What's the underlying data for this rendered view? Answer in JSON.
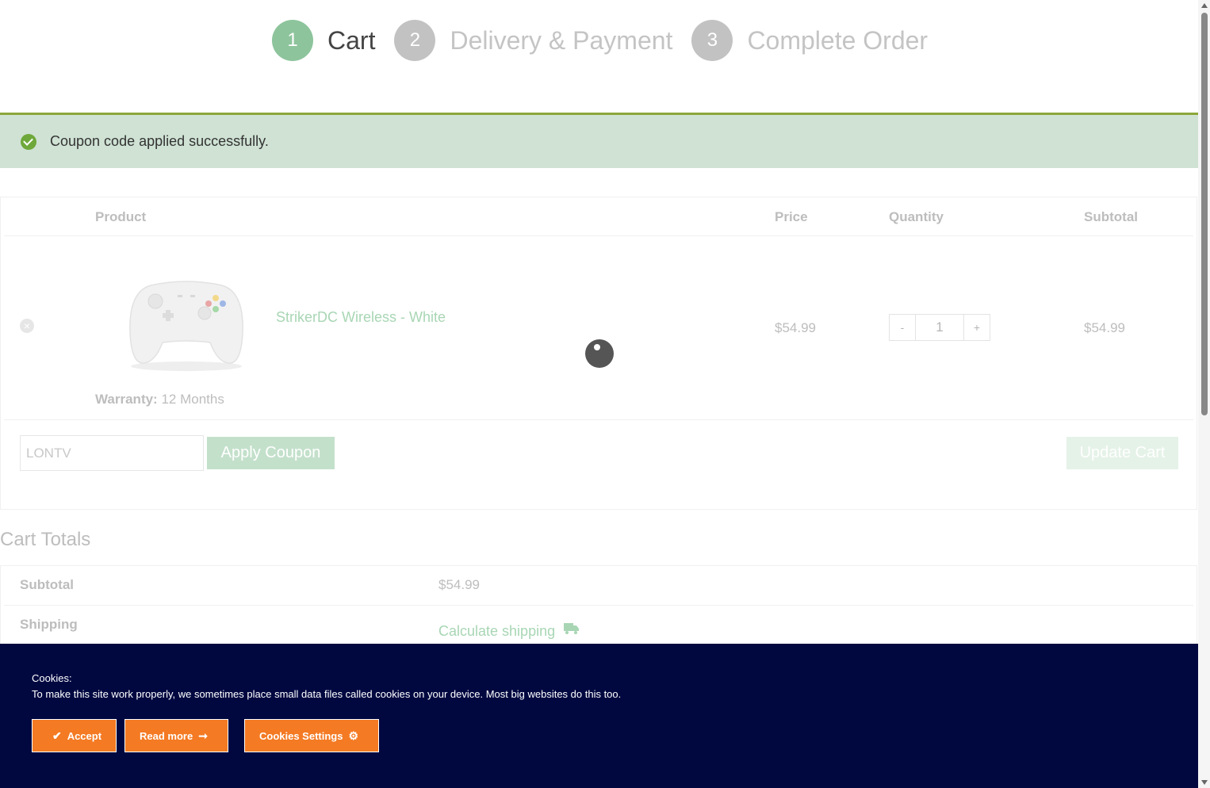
{
  "steps": [
    {
      "num": "1",
      "label": "Cart"
    },
    {
      "num": "2",
      "label": "Delivery & Payment"
    },
    {
      "num": "3",
      "label": "Complete Order"
    }
  ],
  "notice": {
    "text": "Coupon code applied successfully.",
    "color": "#cfe2d4"
  },
  "cart": {
    "headers": {
      "product": "Product",
      "price": "Price",
      "quantity": "Quantity",
      "subtotal": "Subtotal"
    },
    "item": {
      "name": "StrikerDC Wireless - White",
      "warranty_label": "Warranty:",
      "warranty_value": "12 Months",
      "price": "$54.99",
      "qty_minus": "-",
      "qty_value": "1",
      "qty_plus": "+",
      "subtotal": "$54.99"
    },
    "coupon_value": "LONTV",
    "apply_label": "Apply Coupon",
    "update_label": "Update Cart"
  },
  "totals": {
    "title": "Cart Totals",
    "subtotal_label": "Subtotal",
    "subtotal_value": "$54.99",
    "shipping_label": "Shipping",
    "shipping_link": "Calculate shipping"
  },
  "cookie": {
    "title": "Cookies:",
    "text": "To make this site work properly, we sometimes place small data files called cookies on your device. Most big websites do this too.",
    "accept": "Accept",
    "read_more": "Read more",
    "settings": "Cookies Settings",
    "bg_color": "#010840",
    "btn_color": "#f47a23"
  },
  "accent": "#8dc49c"
}
